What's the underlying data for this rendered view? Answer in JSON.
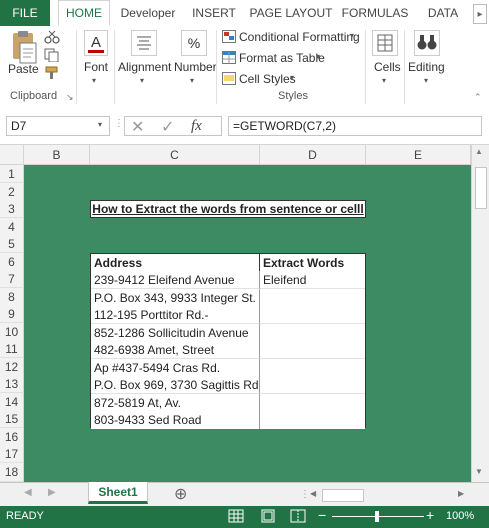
{
  "ribbon": {
    "tabs": [
      "FILE",
      "HOME",
      "Developer",
      "INSERT",
      "PAGE LAYOUT",
      "FORMULAS",
      "DATA"
    ],
    "active_tab": "HOME",
    "clipboard": {
      "paste": "Paste",
      "group_label": "Clipboard"
    },
    "font": {
      "label": "Font"
    },
    "alignment": {
      "label": "Alignment"
    },
    "number": {
      "label": "Number"
    },
    "styles": {
      "conditional_formatting": "Conditional Formatting",
      "format_as_table": "Format as Table",
      "cell_styles": "Cell Styles",
      "group_label": "Styles"
    },
    "cells": {
      "label": "Cells"
    },
    "editing": {
      "label": "Editing"
    }
  },
  "formula_bar": {
    "name_box": "D7",
    "fx": "fx",
    "formula": "=GETWORD(C7,2)"
  },
  "grid": {
    "columns": [
      "B",
      "C",
      "D",
      "E"
    ],
    "rows": [
      "1",
      "2",
      "3",
      "4",
      "5",
      "6",
      "7",
      "8",
      "9",
      "10",
      "11",
      "12",
      "13",
      "14",
      "15",
      "16",
      "17",
      "18"
    ],
    "title": "How to Extract the words from sentence or celll",
    "table_headers": [
      "Address",
      "Extract Words"
    ],
    "addresses": [
      "239-9412 Eleifend Avenue",
      "P.O. Box 343, 9933 Integer St.",
      "112-195 Porttitor Rd.-",
      "852-1286 Sollicitudin Avenue",
      "482-6938 Amet, Street",
      "Ap #437-5494 Cras Rd.",
      "P.O. Box 969, 3730 Sagittis Rd.",
      "872-5819 At, Av.",
      "803-9433 Sed Road"
    ],
    "extracted": [
      "Eleifend",
      "",
      "",
      "",
      "",
      "",
      "",
      "",
      ""
    ],
    "sheet_color": "#3d8b63"
  },
  "sheet_tabs": {
    "active": "Sheet1",
    "add": "⊕"
  },
  "status": {
    "ready": "READY",
    "zoom": "100%"
  },
  "colors": {
    "brand": "#217346"
  }
}
